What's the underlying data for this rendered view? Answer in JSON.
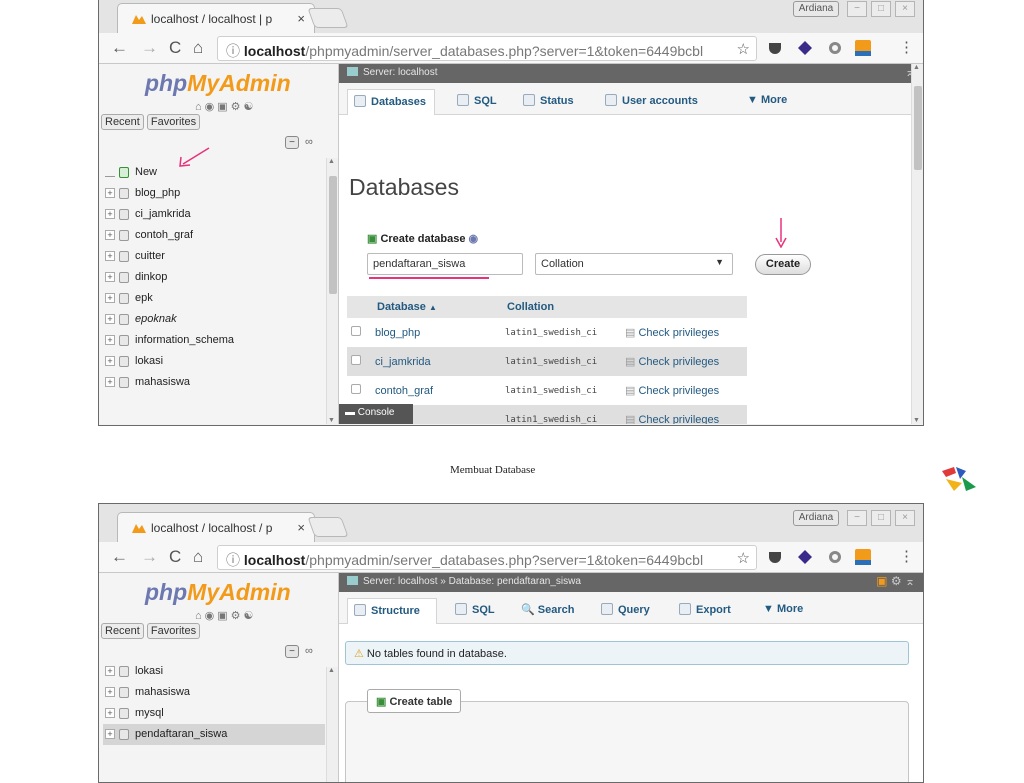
{
  "caption": "Membuat Database",
  "browser": {
    "tab1_title": "localhost / localhost | p",
    "tab2_title": "localhost / localhost / p",
    "tab_close": "×",
    "url_host": "localhost",
    "url1_path": "/phpmyadmin/server_databases.php?server=1&token=6449bcbl",
    "url2_path": "/phpmyadmin/server_databases.php?server=1&token=6449bcbl",
    "profile_label": "Ardiana",
    "back": "←",
    "forward": "→",
    "reload": "C",
    "home": "⌂",
    "info": "ⓘ",
    "star": "☆",
    "menu": "⋮"
  },
  "nav": {
    "logo_php": "php",
    "logo_my": "MyAdmin",
    "recent": "Recent",
    "favorites": "Favorites",
    "collapse": "−",
    "link": "∞",
    "tree1": [
      "New",
      "blog_php",
      "ci_jamkrida",
      "contoh_graf",
      "cuitter",
      "dinkop",
      "epk",
      "epoknak",
      "information_schema",
      "lokasi",
      "mahasiswa"
    ],
    "tree2": [
      "lokasi",
      "mahasiswa",
      "mysql",
      "pendaftaran_siswa"
    ]
  },
  "screen1": {
    "server_label": "Server: localhost",
    "tabs": [
      "Databases",
      "SQL",
      "Status",
      "User accounts",
      "More"
    ],
    "heading": "Databases",
    "create_label": "Create database",
    "db_name_value": "pendaftaran_siswa",
    "collation_value": "Collation",
    "create_button": "Create",
    "table_headers": [
      "Database",
      "Collation"
    ],
    "rows": [
      {
        "name": "blog_php",
        "collation": "latin1_swedish_ci",
        "action": "Check privileges"
      },
      {
        "name": "ci_jamkrida",
        "collation": "latin1_swedish_ci",
        "action": "Check privileges"
      },
      {
        "name": "contoh_graf",
        "collation": "latin1_swedish_ci",
        "action": "Check privileges"
      },
      {
        "name": "",
        "collation": "latin1_swedish_ci",
        "action": "Check privileges"
      }
    ],
    "console": "Console"
  },
  "screen2": {
    "server_label": "Server: localhost » Database: pendaftaran_siswa",
    "tabs": [
      "Structure",
      "SQL",
      "Search",
      "Query",
      "Export",
      "More"
    ],
    "notice": "No tables found in database.",
    "create_table": "Create table"
  },
  "colors": {
    "accent_pink": "#e8327c",
    "link_blue": "#235a81",
    "server_bar": "#666666"
  }
}
